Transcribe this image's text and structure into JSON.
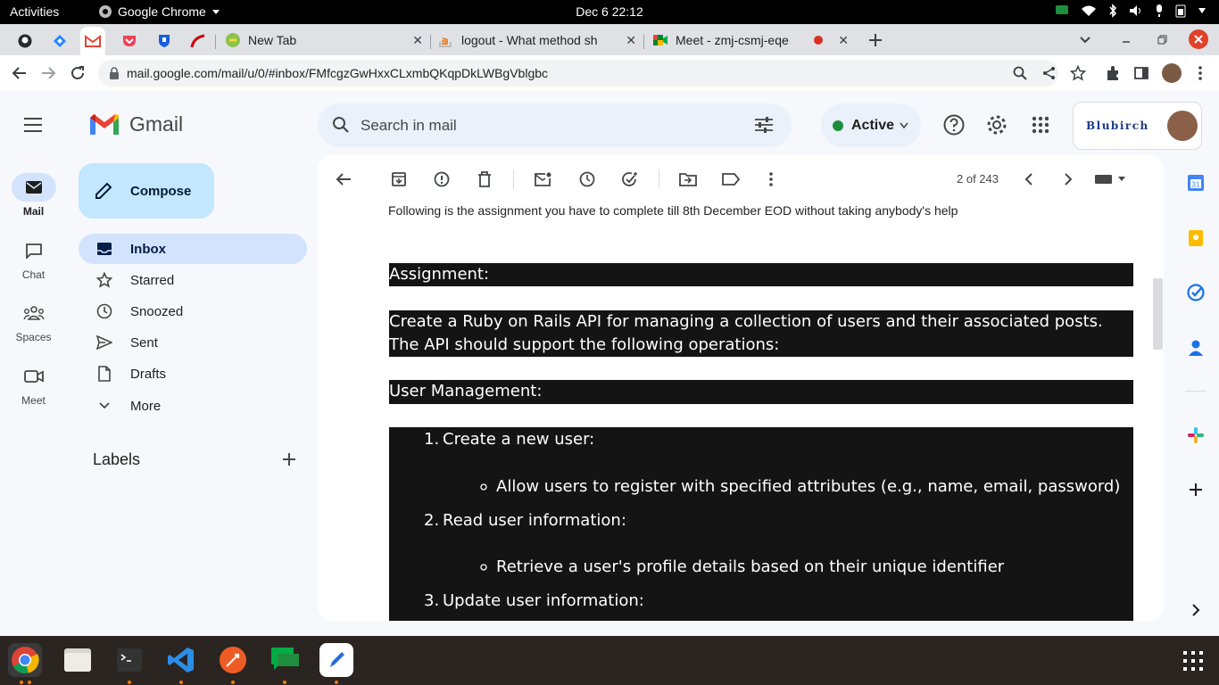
{
  "topbar": {
    "activities": "Activities",
    "app_name": "Google Chrome",
    "datetime": "Dec 6  22:12"
  },
  "tabs": [
    {
      "title": "New Tab"
    },
    {
      "title": "logout - What method sh"
    },
    {
      "title": "Meet - zmj-csmj-eqe"
    }
  ],
  "omnibox": {
    "url": "mail.google.com/mail/u/0/#inbox/FMfcgzGwHxxCLxmbQKqpDkLWBgVblgbc"
  },
  "gmail": {
    "logo_text": "Gmail",
    "rail": [
      {
        "label": "Mail"
      },
      {
        "label": "Chat"
      },
      {
        "label": "Spaces"
      },
      {
        "label": "Meet"
      }
    ],
    "compose_label": "Compose",
    "nav": [
      {
        "label": "Inbox"
      },
      {
        "label": "Starred"
      },
      {
        "label": "Snoozed"
      },
      {
        "label": "Sent"
      },
      {
        "label": "Drafts"
      },
      {
        "label": "More"
      }
    ],
    "labels_heading": "Labels",
    "search_placeholder": "Search in mail",
    "status": "Active",
    "account_brand": "Blubirch",
    "pagination": "2 of 243"
  },
  "email": {
    "intro": "Following is the assignment you have to complete till 8th December EOD without taking anybody's help",
    "assignment_heading": "Assignment:",
    "description": "Create a Ruby on Rails API for managing a collection of users and their associated posts. The API should support the following operations:",
    "user_mgmt_heading": "User Management:",
    "items": [
      {
        "num": "1.",
        "title": "Create a new user:",
        "sub": "Allow users to register with specified attributes (e.g., name, email, password)"
      },
      {
        "num": "2.",
        "title": "Read user information:",
        "sub": "Retrieve a user's profile details based on their unique identifier"
      },
      {
        "num": "3.",
        "title": "Update user information:",
        "sub": ""
      }
    ]
  },
  "colors": {
    "gmail_bg": "#f6f8fc",
    "inbox_highlight": "#d3e3fd",
    "compose_bg": "#c2e7ff",
    "code_block_bg": "#141414",
    "active_green": "#1e8e3e"
  }
}
